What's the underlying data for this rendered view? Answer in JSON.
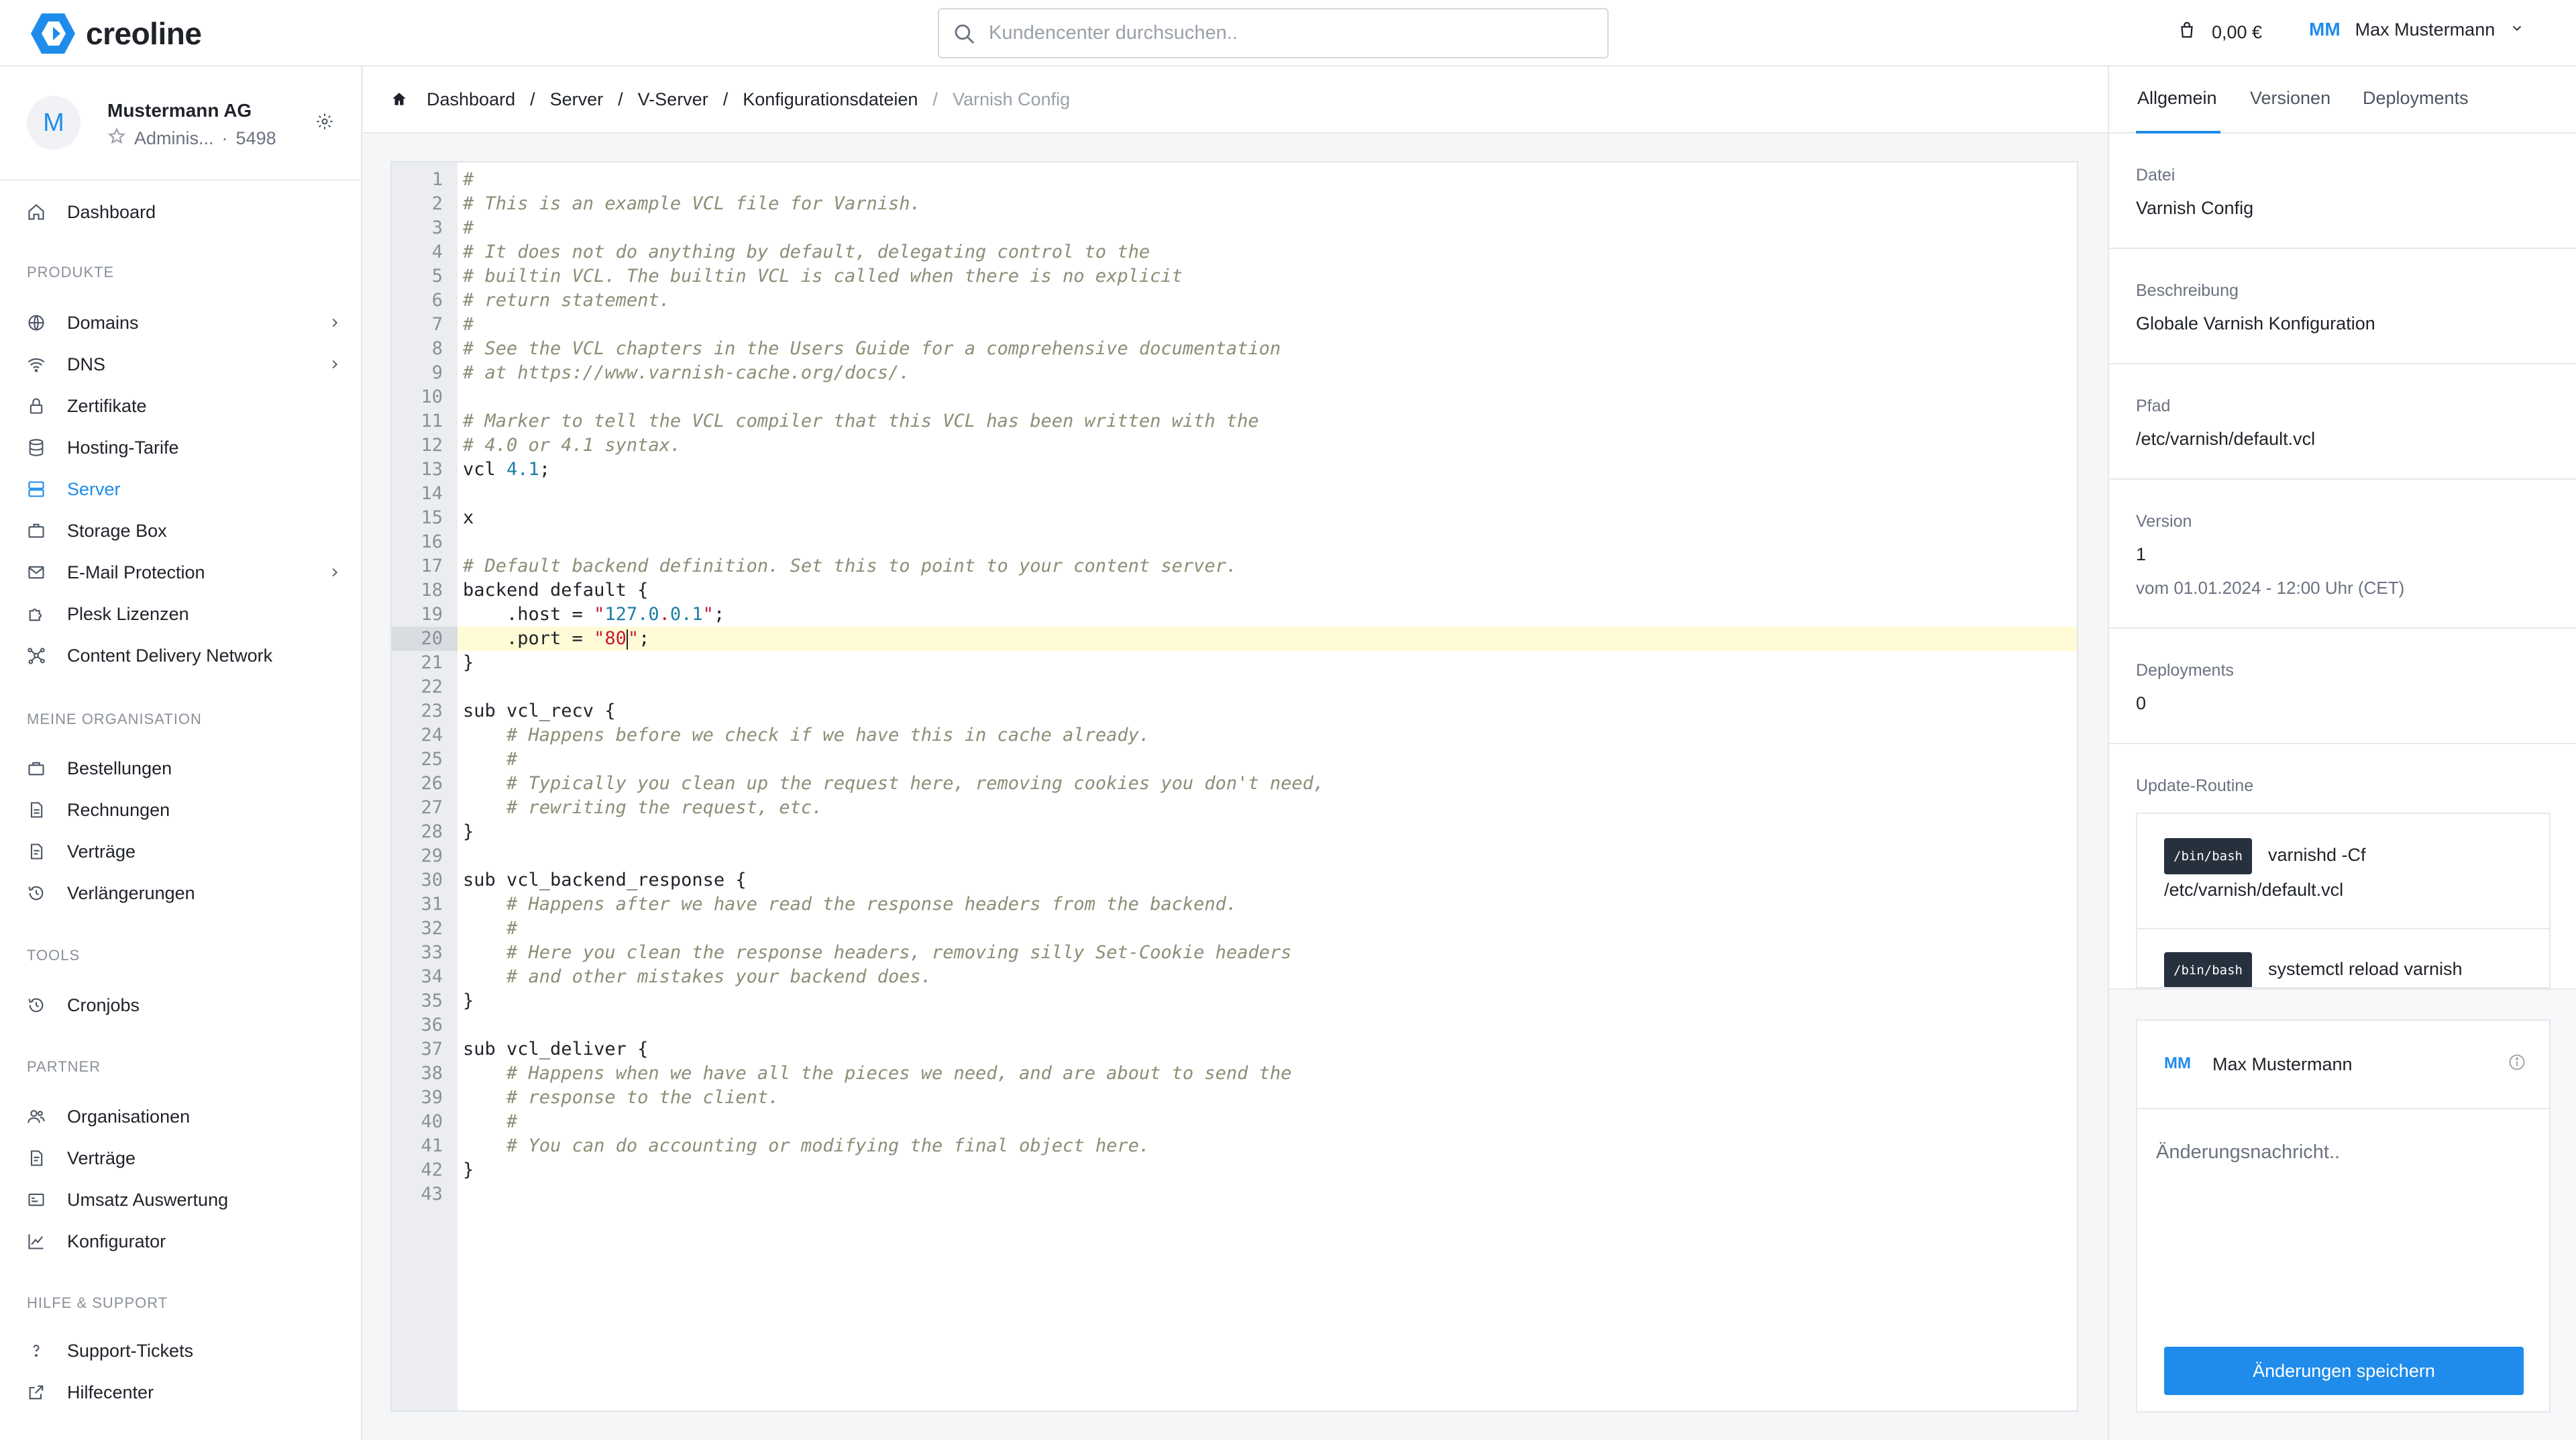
{
  "brand": {
    "name": "creoline",
    "accent": "#1f8ceb"
  },
  "search": {
    "placeholder": "Kundencenter durchsuchen.."
  },
  "header": {
    "cart_amount": "0,00 €",
    "user_initials": "MM",
    "user_name": "Max Mustermann"
  },
  "org": {
    "avatar": "M",
    "name": "Mustermann AG",
    "role": "Adminis...",
    "separator": "·",
    "number": "5498"
  },
  "nav": {
    "dashboard": "Dashboard",
    "section_products": "PRODUKTE",
    "products": [
      "Domains",
      "DNS",
      "Zertifikate",
      "Hosting-Tarife",
      "Server",
      "Storage Box",
      "E-Mail Protection",
      "Plesk Lizenzen",
      "Content Delivery Network"
    ],
    "section_org": "MEINE ORGANISATION",
    "org_items": [
      "Bestellungen",
      "Rechnungen",
      "Verträge",
      "Verlängerungen"
    ],
    "section_tools": "TOOLS",
    "tools": [
      "Cronjobs"
    ],
    "section_partner": "PARTNER",
    "partner": [
      "Organisationen",
      "Verträge",
      "Umsatz Auswertung",
      "Konfigurator"
    ],
    "section_help": "HILFE & SUPPORT",
    "help": [
      "Support-Tickets",
      "Hilfecenter"
    ]
  },
  "breadcrumb": {
    "items": [
      "Dashboard",
      "Server",
      "V-Server",
      "Konfigurationsdateien"
    ],
    "separator": "/",
    "current": "Varnish Config"
  },
  "editor": {
    "highlighted_line": 20,
    "lines": [
      "#",
      "# This is an example VCL file for Varnish.",
      "#",
      "# It does not do anything by default, delegating control to the",
      "# builtin VCL. The builtin VCL is called when there is no explicit",
      "# return statement.",
      "#",
      "# See the VCL chapters in the Users Guide for a comprehensive documentation",
      "# at https://www.varnish-cache.org/docs/.",
      "",
      "# Marker to tell the VCL compiler that this VCL has been written with the",
      "# 4.0 or 4.1 syntax.",
      "vcl 4.1;",
      "",
      "x",
      "",
      "# Default backend definition. Set this to point to your content server.",
      "backend default {",
      "    .host = \"127.0.0.1\";",
      "    .port = \"80\";",
      "}",
      "",
      "sub vcl_recv {",
      "    # Happens before we check if we have this in cache already.",
      "    #",
      "    # Typically you clean up the request here, removing cookies you don't need,",
      "    # rewriting the request, etc.",
      "}",
      "",
      "sub vcl_backend_response {",
      "    # Happens after we have read the response headers from the backend.",
      "    #",
      "    # Here you clean the response headers, removing silly Set-Cookie headers",
      "    # and other mistakes your backend does.",
      "}",
      "",
      "sub vcl_deliver {",
      "    # Happens when we have all the pieces we need, and are about to send the",
      "    # response to the client.",
      "    #",
      "    # You can do accounting or modifying the final object here.",
      "}",
      ""
    ]
  },
  "panel": {
    "tabs": [
      "Allgemein",
      "Versionen",
      "Deployments"
    ],
    "file_label": "Datei",
    "file_value": "Varnish Config",
    "desc_label": "Beschreibung",
    "desc_value": "Globale Varnish Konfiguration",
    "path_label": "Pfad",
    "path_value": "/etc/varnish/default.vcl",
    "version_label": "Version",
    "version_value": "1",
    "version_date": "vom 01.01.2024 - 12:00 Uhr (CET)",
    "deploy_label": "Deployments",
    "deploy_value": "0",
    "routine_label": "Update-Routine",
    "routines": [
      {
        "shell": "/bin/bash",
        "cmd_line1": "varnishd -Cf",
        "cmd_line2": "/etc/varnish/default.vcl"
      },
      {
        "shell": "/bin/bash",
        "cmd_line1": "systemctl reload varnish"
      }
    ],
    "commit_initials": "MM",
    "commit_user": "Max Mustermann",
    "commit_placeholder": "Änderungsnachricht..",
    "save_label": "Änderungen speichern"
  }
}
